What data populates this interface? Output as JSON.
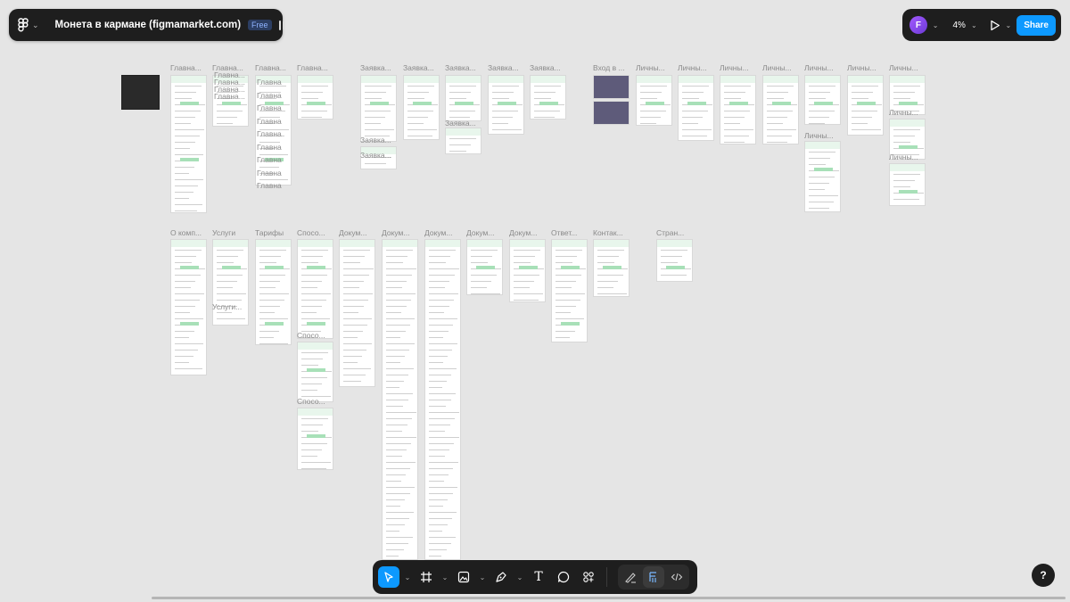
{
  "file": {
    "title": "Монета в кармане (figmamarket.com)",
    "plan_badge": "Free"
  },
  "right": {
    "zoom": "4%",
    "share_label": "Share",
    "avatar_initial": "F"
  },
  "help_label": "?",
  "frames_row1": [
    "Главна...",
    "Главна...",
    "Главна...",
    "Главна...",
    "Заявка...",
    "Заявка...",
    "Заявка...",
    "Заявка...",
    "Заявка...",
    "Вход в ...",
    "Личны...",
    "Личны...",
    "Личны...",
    "Личны...",
    "Личны...",
    "Личны...",
    "Личны..."
  ],
  "frames_row2": [
    "О комп...",
    "Услуги",
    "Тарифы",
    "Спосо...",
    "Докум...",
    "Докум...",
    "Докум...",
    "Докум...",
    "Докум...",
    "Ответ...",
    "Контак...",
    "Стран..."
  ],
  "sublabels": {
    "glavna_stack": [
      "Главна...",
      "Главна...",
      "Главна...",
      "Главна..."
    ],
    "glavna_col3": [
      "Главна",
      "Главна",
      "Главна",
      "Главна",
      "Главна",
      "Главна",
      "Главна",
      "Главна",
      "Главна"
    ],
    "zayavka_sub": [
      "Заявка...",
      "Заявка...",
      "Заявка..."
    ],
    "lichny_sub": [
      "Личны...",
      "Личны...",
      "Личны..."
    ],
    "uslugi_sub": "Услуги...",
    "sposo_sub": [
      "Спосо...",
      "Спосо..."
    ]
  }
}
